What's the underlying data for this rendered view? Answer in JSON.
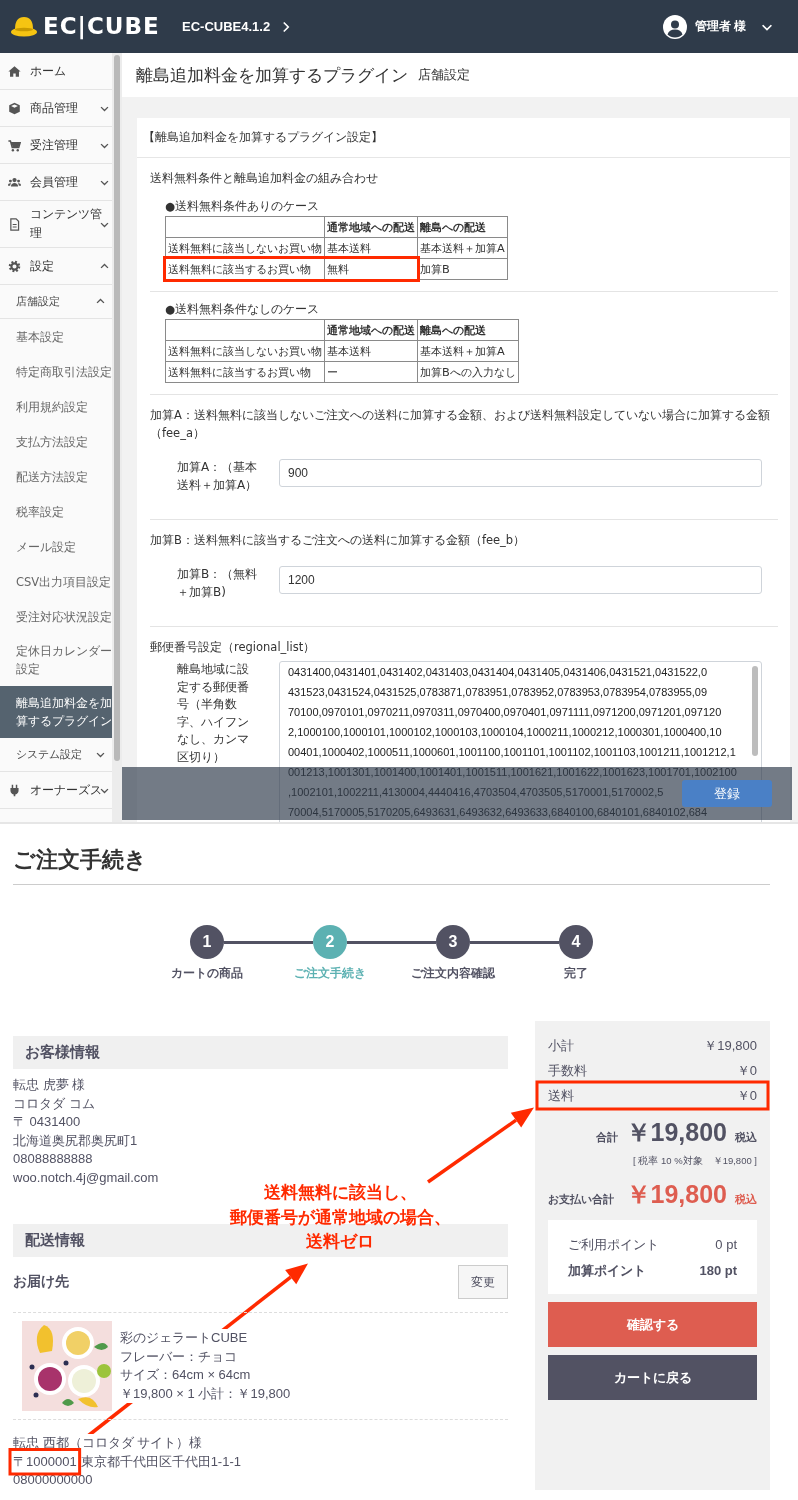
{
  "header": {
    "logo": "EC|CUBE",
    "shop_name": "EC-CUBE4.1.2",
    "user": "管理者 様"
  },
  "sidebar": {
    "items": [
      {
        "label": "ホーム"
      },
      {
        "label": "商品管理",
        "expanded": false
      },
      {
        "label": "受注管理",
        "expanded": false
      },
      {
        "label": "会員管理",
        "expanded": false
      },
      {
        "label": "コンテンツ管理",
        "expanded": false
      },
      {
        "label": "設定",
        "expanded": true,
        "children": [
          {
            "label": "店舗設定",
            "expanded": true,
            "children": [
              {
                "label": "基本設定",
                "selected": false
              },
              {
                "label": "特定商取引法設定",
                "selected": false
              },
              {
                "label": "利用規約設定",
                "selected": false
              },
              {
                "label": "支払方法設定",
                "selected": false
              },
              {
                "label": "配送方法設定",
                "selected": false
              },
              {
                "label": "税率設定",
                "selected": false
              },
              {
                "label": "メール設定",
                "selected": false
              },
              {
                "label": "CSV出力項目設定",
                "selected": false
              },
              {
                "label": "受注対応状況設定",
                "selected": false
              },
              {
                "label": "定休日カレンダー設定",
                "selected": false
              },
              {
                "label": "離島追加料金を加算するプラグイン",
                "selected": true
              }
            ]
          },
          {
            "label": "システム設定",
            "expanded": false
          }
        ]
      },
      {
        "label": "オーナーズス",
        "expanded": false
      }
    ]
  },
  "main": {
    "title": "離島追加料金を加算するプラグイン",
    "subtitle": "店舗設定",
    "card_title": "【離島追加料金を加算するプラグイン設定】",
    "combination": {
      "heading": "送料無料条件と離島追加料金の組み合わせ",
      "tables": [
        {
          "caption": "●送料無料条件ありのケース",
          "columns": [
            "",
            "通常地域への配送",
            "離島への配送"
          ],
          "rows": [
            {
              "cells": [
                "送料無料に該当しないお買い物",
                "基本送料",
                "基本送料＋加算A"
              ]
            },
            {
              "cells": [
                "送料無料に該当するお買い物",
                "無料",
                "加算B"
              ]
            }
          ]
        },
        {
          "caption": "●送料無料条件なしのケース",
          "columns": [
            "",
            "通常地域への配送",
            "離島への配送"
          ],
          "rows": [
            {
              "cells": [
                "送料無料に該当しないお買い物",
                "基本送料",
                "基本送料＋加算A"
              ]
            },
            {
              "cells": [
                "送料無料に該当するお買い物",
                "ー",
                "加算Bへの入力なし"
              ]
            }
          ]
        }
      ]
    },
    "fields": [
      {
        "description": "加算A：送料無料に該当しないご注文への送料に加算する金額、および送料無料設定していない場合に加算する金額（fee_a）",
        "label": "加算A：（基本送料＋加算A）",
        "value": "900"
      },
      {
        "description": "加算B：送料無料に該当するご注文への送料に加算する金額（fee_b）",
        "label": "加算B：（無料＋加算B)",
        "value": "1200"
      }
    ],
    "postal": {
      "description": "郵便番号設定（regional_list）",
      "label": "離島地域に設定する郵便番号（半角数字、ハイフンなし、カンマ区切り）",
      "lines": [
        "0431400,0431401,0431402,0431403,0431404,0431405,0431406,0431521,0431522,0",
        "431523,0431524,0431525,0783871,0783951,0783952,0783953,0783954,0783955,09",
        "70100,0970101,0970211,0970311,0970400,0970401,0971111,0971200,0971201,097120",
        "2,1000100,1000101,1000102,1000103,1000104,1000211,1000212,1000301,1000400,10",
        "00401,1000402,1000511,1000601,1001100,1001101,1001102,1001103,1001211,1001212,1",
        "001213,1001301,1001400,1001401,1001511,1001621,1001622,1001623,1001701,1002100",
        ",1002101,1002211,4130004,4440416,4703504,4703505,5170001,5170002,5",
        "70004,5170005,5170205,6493631,6493632,6493633,6840100,6840101,6840102,684"
      ]
    },
    "save_button": "登録"
  },
  "checkout": {
    "title": "ご注文手続き",
    "steps": [
      {
        "number": "1",
        "label": "カートの商品",
        "selected": false
      },
      {
        "number": "2",
        "label": "ご注文手続き",
        "selected": true
      },
      {
        "number": "3",
        "label": "ご注文内容確認",
        "selected": false
      },
      {
        "number": "4",
        "label": "完了",
        "selected": false
      }
    ],
    "customer": {
      "heading": "お客様情報",
      "lines": [
        "転忠 虎夢 様",
        "コロタダ コム",
        "〒 0431400",
        "北海道奥尻郡奥尻町1",
        "08088888888",
        "woo.notch.4j@gmail.com"
      ]
    },
    "shipping": {
      "heading": "配送情報",
      "destination_label": "お届け先",
      "change_button": "変更",
      "product": {
        "kind": "picture",
        "lines": [
          "彩のジェラートCUBE",
          "フレーバー：チョコ",
          "サイズ：64cm × 64cm",
          "￥19,800 × 1 小計：￥19,800"
        ]
      },
      "recipient": {
        "name": "転忠 西都（コロタダ サイト）様",
        "postal_code": "〒1000001",
        "address": "東京都千代田区千代田1-1-1",
        "phone": "08000000000"
      }
    },
    "summary": {
      "rows": [
        {
          "label": "小計",
          "value": "￥19,800"
        },
        {
          "label": "手数料",
          "value": "￥0"
        },
        {
          "label": "送料",
          "value": "￥0"
        }
      ],
      "total": {
        "label": "合計",
        "value": "￥19,800",
        "tax": "税込"
      },
      "tax_note": "[ 税率 10 %対象　￥19,800 ]",
      "payment_total": {
        "label": "お支払い合計",
        "value": "￥19,800",
        "tax": "税込"
      },
      "points": [
        {
          "label": "ご利用ポイント",
          "value": "0 pt"
        },
        {
          "label": "加算ポイント",
          "value": "180 pt"
        }
      ],
      "buttons": [
        {
          "label": "確認する",
          "kind": "primary"
        },
        {
          "label": "カートに戻る",
          "kind": "secondary"
        }
      ]
    }
  },
  "annotation": {
    "lines": [
      "送料無料に該当し、",
      "郵便番号が通常地域の場合、",
      "送料ゼロ"
    ]
  }
}
